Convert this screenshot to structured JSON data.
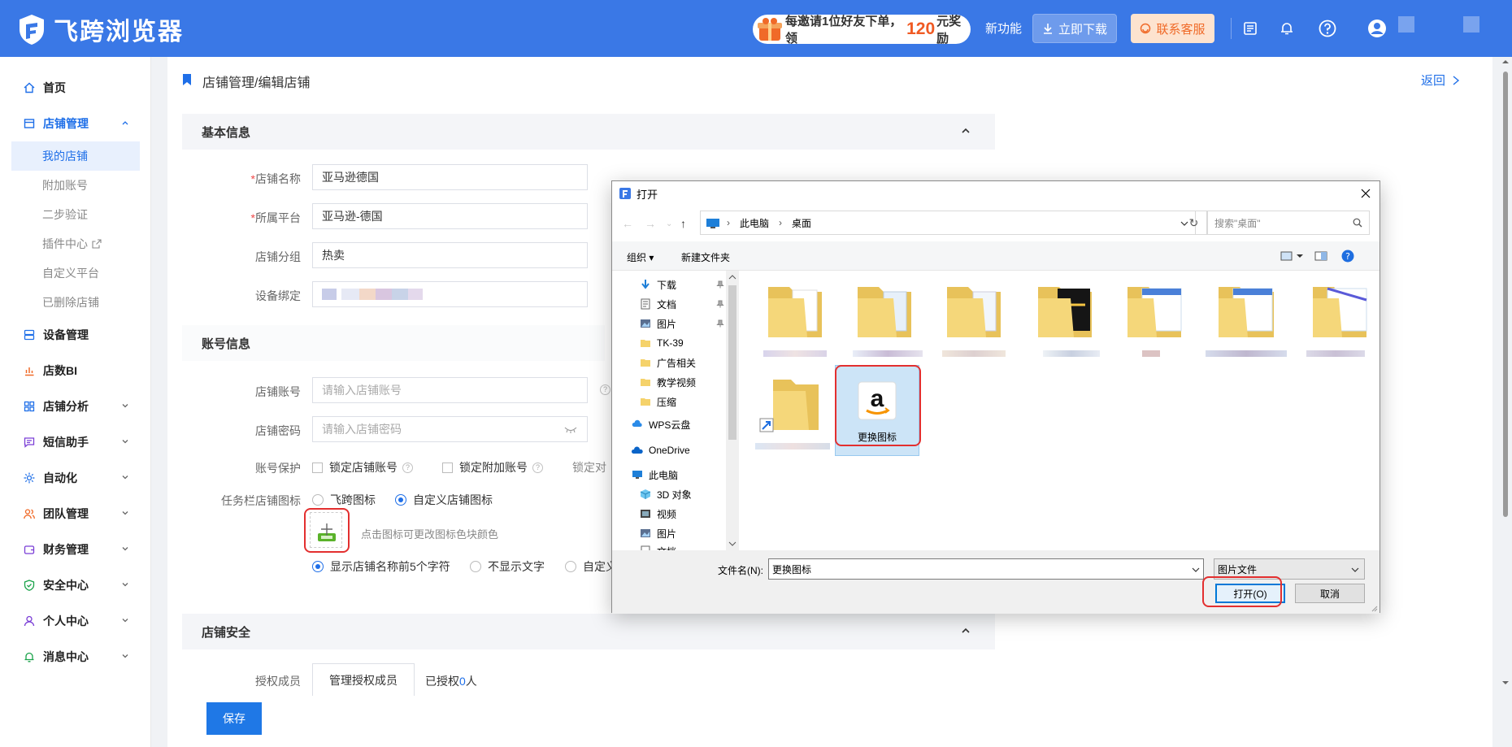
{
  "app": {
    "name": "飞跨浏览器"
  },
  "topbar": {
    "promo_prefix": "每邀请1位好友下单，领",
    "promo_amount": "120",
    "promo_suffix": "元奖励",
    "new_feature": "新功能",
    "download": "立即下载",
    "support": "联系客服"
  },
  "sidebar": {
    "home": "首页",
    "store_mgmt": "店铺管理",
    "sub": [
      "我的店铺",
      "附加账号",
      "二步验证",
      "插件中心",
      "自定义平台",
      "已删除店铺"
    ],
    "items": [
      "设备管理",
      "店数BI",
      "店铺分析",
      "短信助手",
      "自动化",
      "团队管理",
      "财务管理",
      "安全中心",
      "个人中心",
      "消息中心"
    ]
  },
  "page": {
    "breadcrumb": "店铺管理/编辑店铺",
    "back": "返回",
    "save": "保存"
  },
  "basic": {
    "title": "基本信息",
    "name_label": "店铺名称",
    "name_value": "亚马逊德国",
    "platform_label": "所属平台",
    "platform_value": "亚马逊-德国",
    "group_label": "店铺分组",
    "group_value": "热卖",
    "device_label": "设备绑定"
  },
  "account": {
    "title": "账号信息",
    "acct_label": "店铺账号",
    "acct_placeholder": "请输入店铺账号",
    "pwd_label": "店铺密码",
    "pwd_placeholder": "请输入店铺密码",
    "protect_label": "账号保护",
    "lock_acct": "锁定店铺账号",
    "lock_extra": "锁定附加账号",
    "lock_other": "锁定对",
    "taskbar_label": "任务栏店铺图标",
    "opt_feikua": "飞跨图标",
    "opt_custom": "自定义店铺图标",
    "icon_hint": "点击图标可更改图标色块颜色",
    "show_first5": "显示店铺名称前5个字符",
    "no_text": "不显示文字",
    "custom_text": "自定义"
  },
  "security": {
    "title": "店铺安全",
    "auth_label": "授权成员",
    "manage_btn": "管理授权成员",
    "authorized_prefix": "已授权",
    "authorized_count": "0",
    "authorized_suffix": "人"
  },
  "dialog": {
    "title": "打开",
    "path_pc": "此电脑",
    "path_desktop": "桌面",
    "search_placeholder": "搜索\"桌面\"",
    "organize": "组织",
    "new_folder": "新建文件夹",
    "tree": [
      "下载",
      "文档",
      "图片",
      "TK-39",
      "广告相关",
      "教学视频",
      "压缩",
      "WPS云盘",
      "OneDrive",
      "此电脑",
      "3D 对象",
      "视频",
      "图片",
      "文档"
    ],
    "selected_file": "更换图标",
    "filename_label": "文件名(N):",
    "filename_value": "更换图标",
    "filetype": "图片文件",
    "open": "打开(O)",
    "cancel": "取消"
  },
  "colors": {
    "brand": "#3a78e6",
    "accent": "#1f6fe8",
    "highlight": "#e32f2f"
  }
}
